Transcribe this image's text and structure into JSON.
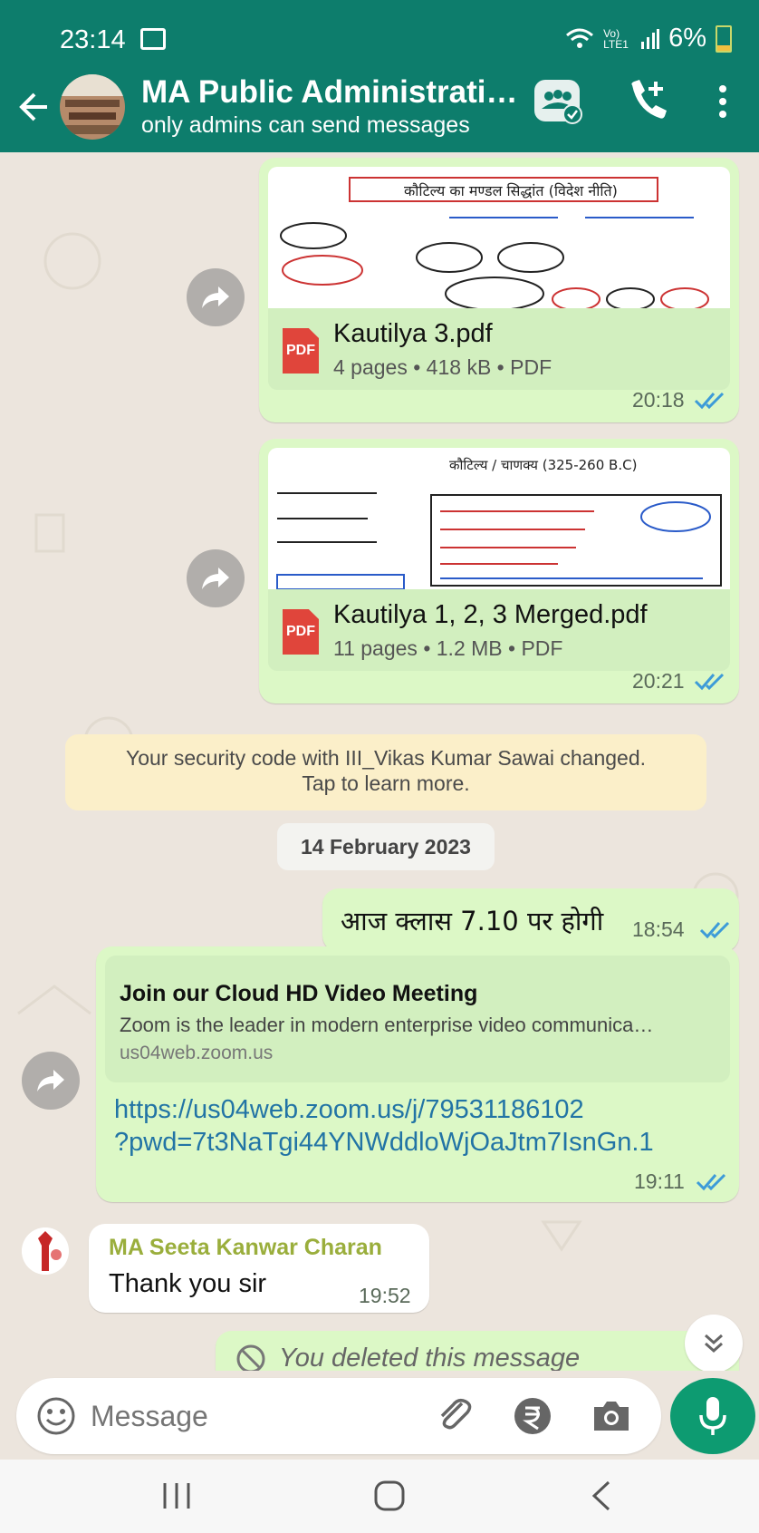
{
  "status_bar": {
    "time": "23:14",
    "network": "Vo) LTE1",
    "battery": "6%"
  },
  "header": {
    "title": "MA Public Administrati…",
    "subtitle": "only admins can send messages"
  },
  "messages": {
    "file1": {
      "name": "Kautilya 3.pdf",
      "meta": "4 pages • 418 kB • PDF",
      "time": "20:18",
      "thumb_title": "कौटिल्य का मण्डल सिद्धांत (विदेश नीति)"
    },
    "file2": {
      "name": "Kautilya 1, 2, 3 Merged.pdf",
      "meta": "11 pages • 1.2 MB • PDF",
      "time": "20:21",
      "thumb_title": "कौटिल्य / चाणक्य (325-260 B.C)"
    },
    "security": {
      "line1": "Your security code with III_Vikas Kumar Sawai changed.",
      "line2": "Tap to learn more."
    },
    "date": "14 February 2023",
    "text1": {
      "text": "आज क्लास 7.10 पर होगी",
      "time": "18:54"
    },
    "link": {
      "title": "Join our Cloud HD Video Meeting",
      "desc": "Zoom is the leader in modern enterprise video communica…",
      "domain": "us04web.zoom.us",
      "url_line1": "https://us04web.zoom.us/j/79531186102",
      "url_line2": "?pwd=7t3NaTgi44YNWddloWjOaJtm7IsnGn.1",
      "time": "19:11"
    },
    "incoming": {
      "sender": "MA Seeta Kanwar Charan",
      "text": "Thank you sir",
      "time": "19:52"
    },
    "deleted": {
      "text": "You deleted this message"
    }
  },
  "composer": {
    "placeholder": "Message"
  },
  "pdf_label": "PDF",
  "colors": {
    "header": "#0d7d6c",
    "accent": "#0d9b71",
    "tick": "#3d9bd8",
    "link": "#2274a5"
  }
}
